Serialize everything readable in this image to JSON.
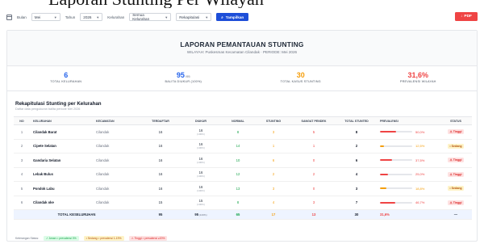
{
  "top_caption": "Laporan Stunting Per Wilayah",
  "filters": {
    "bulan_label": "Bulan",
    "bulan_value": "Mei",
    "tahun_label": "Tahun",
    "tahun_value": "2026",
    "kelurahan_label": "Kelurahan",
    "kelurahan_value": "Semua Kelurahan",
    "mode_value": "Rekapitulasi",
    "show_button": "Tampilkan",
    "pdf_button": "PDF"
  },
  "report": {
    "title": "LAPORAN PEMANTAUAN STUNTING",
    "subtitle": "WILAYAH: Puskesmas Kecamatan Cilandak · PERIODE: Mei 2026"
  },
  "kpis": [
    {
      "value": "6",
      "unit": "",
      "label": "TOTAL KELURAHAN",
      "color": "#2563eb"
    },
    {
      "value": "95",
      "unit": "/95",
      "label": "BALITA DIUKUR (100%)",
      "color": "#2563eb"
    },
    {
      "value": "30",
      "unit": "",
      "label": "TOTAL KASUS STUNTING",
      "color": "#f59e0b"
    },
    {
      "value": "31,6%",
      "unit": "",
      "label": "PREVALENSI WILAYAH",
      "color": "#ef4444"
    }
  ],
  "section": {
    "title": "Rekapitulasi Stunting per Kelurahan",
    "subtitle": "Daftar data pengukuran balita periode Mei 2026"
  },
  "table": {
    "headers": [
      "NO",
      "KELURAHAN",
      "KECAMATAN",
      "TERDAFTAR",
      "DIUKUR",
      "NORMAL",
      "STUNTING",
      "SANGAT PENDEK",
      "TOTAL STUNTED",
      "PREVALENSI",
      "STATUS"
    ],
    "rows": [
      {
        "no": "1",
        "kel": "Cilandak Barat",
        "kec": "Cilandak",
        "terdaftar": "16",
        "diukur": "16",
        "diukur_pct": "(100%)",
        "normal": "8",
        "stunting": "3",
        "sangat": "5",
        "total": "8",
        "prev_label": "50,0%",
        "prev": 0.5,
        "prev_color": "#ef4444",
        "status": "⚠ Tinggi",
        "status_type": "red"
      },
      {
        "no": "2",
        "kel": "Cipete Selatan",
        "kec": "Cilandak",
        "terdaftar": "16",
        "diukur": "16",
        "diukur_pct": "(100%)",
        "normal": "14",
        "stunting": "1",
        "sangat": "1",
        "total": "2",
        "prev_label": "12,5%",
        "prev": 0.125,
        "prev_color": "#f59e0b",
        "status": "• Sedang",
        "status_type": "yellow"
      },
      {
        "no": "3",
        "kel": "Gandaria Selatan",
        "kec": "Cilandak",
        "terdaftar": "16",
        "diukur": "16",
        "diukur_pct": "(100%)",
        "normal": "10",
        "stunting": "6",
        "sangat": "0",
        "total": "6",
        "prev_label": "37,5%",
        "prev": 0.375,
        "prev_color": "#ef4444",
        "status": "⚠ Tinggi",
        "status_type": "red"
      },
      {
        "no": "4",
        "kel": "Lebak Bulus",
        "kec": "Cilandak",
        "terdaftar": "16",
        "diukur": "16",
        "diukur_pct": "(100%)",
        "normal": "12",
        "stunting": "2",
        "sangat": "2",
        "total": "4",
        "prev_label": "25,0%",
        "prev": 0.25,
        "prev_color": "#ef4444",
        "status": "⚠ Tinggi",
        "status_type": "red"
      },
      {
        "no": "5",
        "kel": "Pondok Labu",
        "kec": "Cilandak",
        "terdaftar": "16",
        "diukur": "16",
        "diukur_pct": "(100%)",
        "normal": "13",
        "stunting": "3",
        "sangat": "0",
        "total": "3",
        "prev_label": "18,8%",
        "prev": 0.188,
        "prev_color": "#f59e0b",
        "status": "• Sedang",
        "status_type": "yellow"
      },
      {
        "no": "6",
        "kel": "Cilandak oke",
        "kec": "Cilandak",
        "terdaftar": "15",
        "diukur": "15",
        "diukur_pct": "(100%)",
        "normal": "8",
        "stunting": "4",
        "sangat": "3",
        "total": "7",
        "prev_label": "46,7%",
        "prev": 0.467,
        "prev_color": "#ef4444",
        "status": "⚠ Tinggi",
        "status_type": "red"
      }
    ],
    "total": {
      "label": "TOTAL KESELURUHAN",
      "terdaftar": "95",
      "diukur": "95",
      "diukur_pct": "(100%)",
      "normal": "65",
      "stunting": "17",
      "sangat": "13",
      "total": "30",
      "prev": "31,6%",
      "status": "—"
    }
  },
  "legend": {
    "label": "Keterangan Status:",
    "items": [
      "✓ Aman = prevalensi 0%",
      "• Sedang = prevalensi 1-19%",
      "⚠ Tinggi = prevalensi ≥20%"
    ]
  }
}
